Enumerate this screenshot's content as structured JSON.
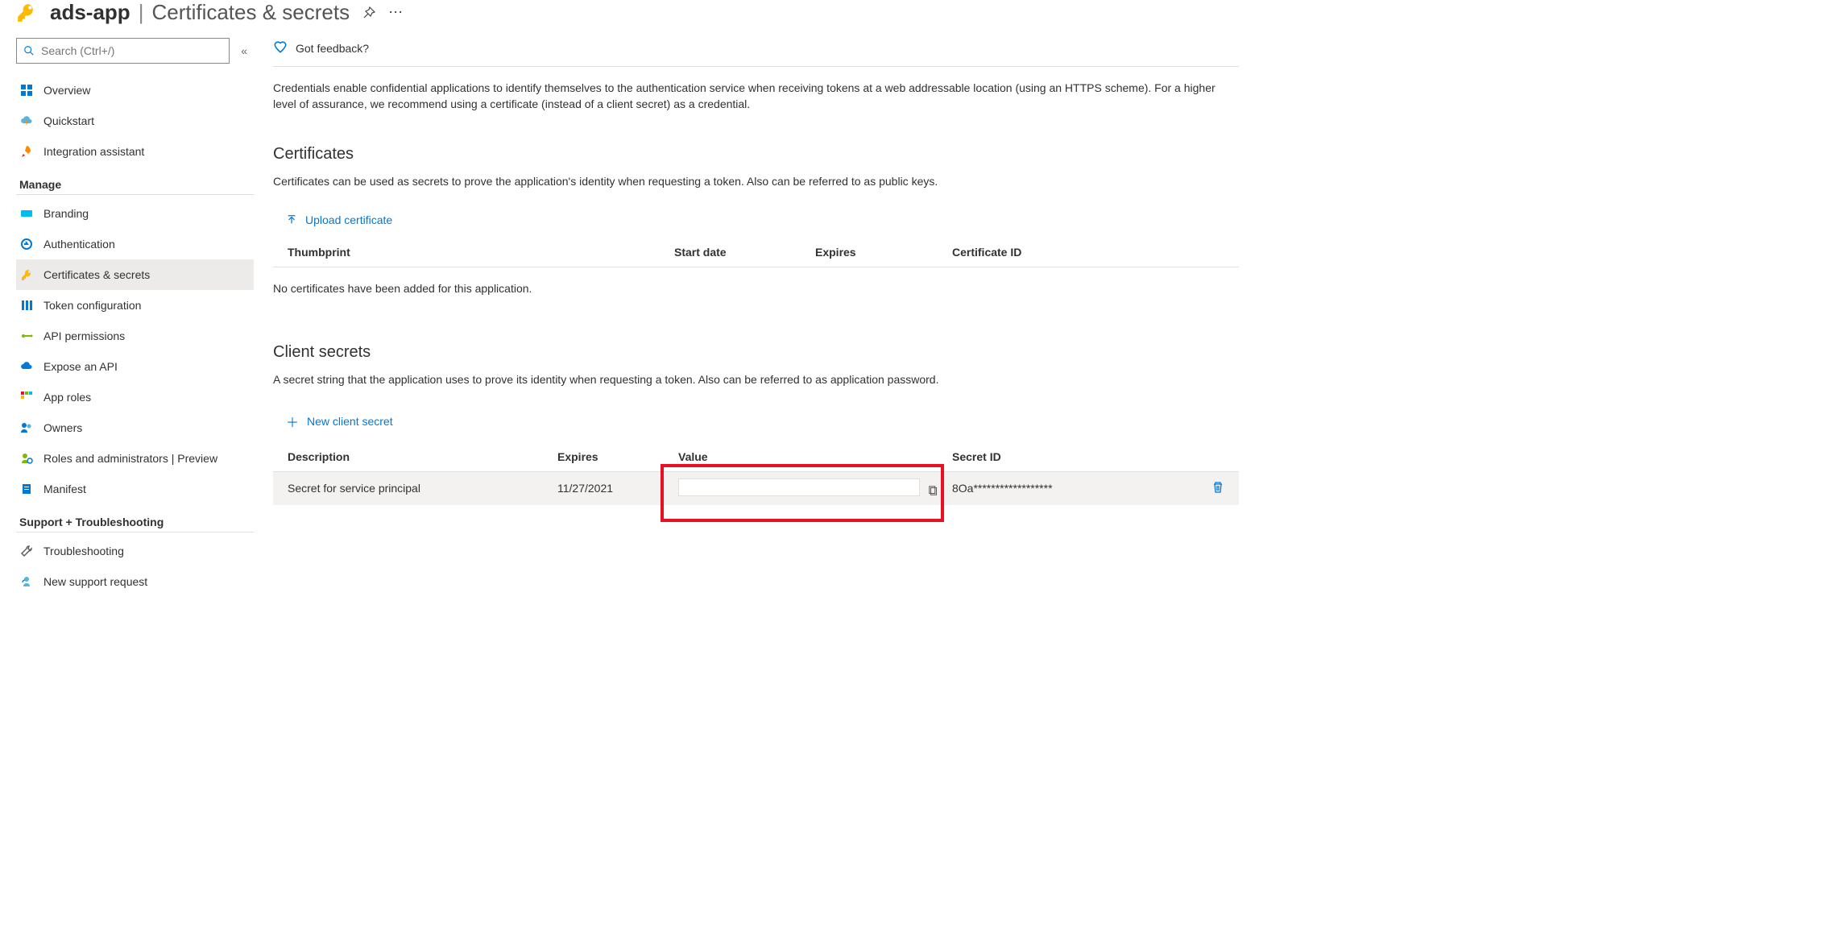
{
  "header": {
    "app_name": "ads-app",
    "page_title": "Certificates & secrets"
  },
  "search": {
    "placeholder": "Search (Ctrl+/)"
  },
  "nav_top": [
    {
      "label": "Overview"
    },
    {
      "label": "Quickstart"
    },
    {
      "label": "Integration assistant"
    }
  ],
  "nav_manage_header": "Manage",
  "nav_manage": [
    {
      "label": "Branding"
    },
    {
      "label": "Authentication"
    },
    {
      "label": "Certificates & secrets"
    },
    {
      "label": "Token configuration"
    },
    {
      "label": "API permissions"
    },
    {
      "label": "Expose an API"
    },
    {
      "label": "App roles"
    },
    {
      "label": "Owners"
    },
    {
      "label": "Roles and administrators | Preview"
    },
    {
      "label": "Manifest"
    }
  ],
  "nav_support_header": "Support + Troubleshooting",
  "nav_support": [
    {
      "label": "Troubleshooting"
    },
    {
      "label": "New support request"
    }
  ],
  "feedback_label": "Got feedback?",
  "intro": "Credentials enable confidential applications to identify themselves to the authentication service when receiving tokens at a web addressable location (using an HTTPS scheme). For a higher level of assurance, we recommend using a certificate (instead of a client secret) as a credential.",
  "certificates": {
    "title": "Certificates",
    "desc": "Certificates can be used as secrets to prove the application's identity when requesting a token. Also can be referred to as public keys.",
    "upload_label": "Upload certificate",
    "cols": {
      "thumbprint": "Thumbprint",
      "start": "Start date",
      "expires": "Expires",
      "id": "Certificate ID"
    },
    "empty": "No certificates have been added for this application."
  },
  "secrets": {
    "title": "Client secrets",
    "desc": "A secret string that the application uses to prove its identity when requesting a token. Also can be referred to as application password.",
    "new_label": "New client secret",
    "cols": {
      "desc": "Description",
      "expires": "Expires",
      "value": "Value",
      "id": "Secret ID"
    },
    "rows": [
      {
        "desc": "Secret for service principal",
        "expires": "11/27/2021",
        "value": "",
        "id": "8Oa******************"
      }
    ]
  }
}
